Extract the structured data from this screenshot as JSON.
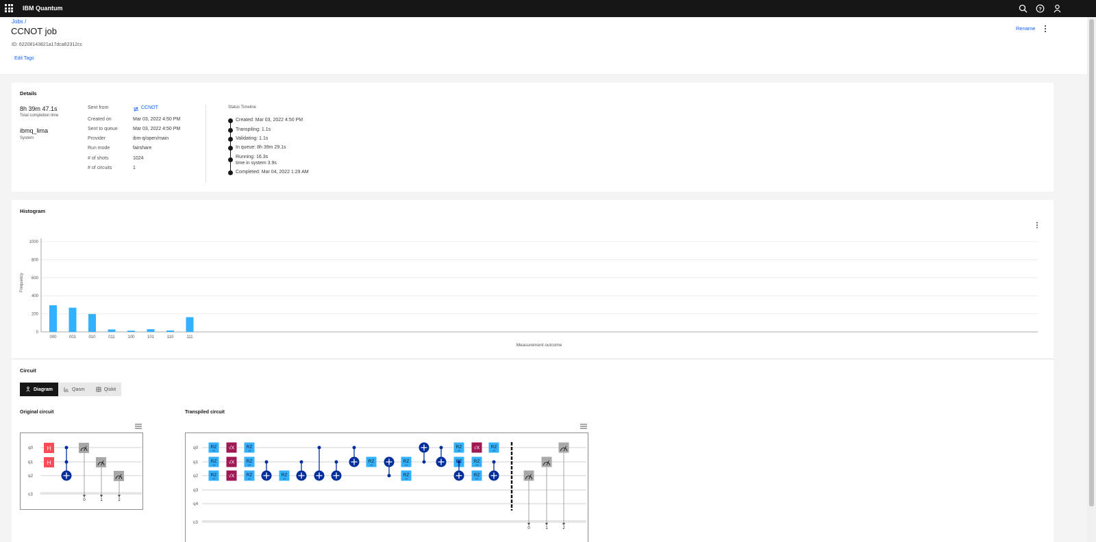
{
  "topbar": {
    "brand": "IBM Quantum",
    "icons": [
      "app-switcher-icon",
      "search-icon",
      "help-icon",
      "user-icon"
    ]
  },
  "header": {
    "breadcrumb": "Jobs /",
    "title": "CCNOT job",
    "job_id": "ID: 62208143821a17dca62312cc",
    "edit_tags": "Edit Tags",
    "rename": "Rename"
  },
  "details": {
    "title": "Details",
    "total_time": "8h 39m 47.1s",
    "total_time_label": "Total completion time",
    "system": "ibmq_lima",
    "system_label": "System",
    "rows": [
      {
        "label": "Sent from",
        "value": "CCNOT"
      },
      {
        "label": "Created on",
        "value": "Mar 03, 2022 4:50 PM"
      },
      {
        "label": "Sent to queue",
        "value": "Mar 03, 2022 4:50 PM"
      },
      {
        "label": "Provider",
        "value": "ibm-q/open/main"
      },
      {
        "label": "Run mode",
        "value": "fairshare"
      },
      {
        "label": "# of shots",
        "value": "1024"
      },
      {
        "label": "# of circuits",
        "value": "1"
      }
    ],
    "timeline_title": "Status Timeline",
    "timeline": [
      {
        "text": "Created: Mar 03, 2022 4:50 PM"
      },
      {
        "text": "Transpiling: 1.1s"
      },
      {
        "text": "Validating: 1.1s"
      },
      {
        "text": "In queue: 8h 39m 29.1s"
      },
      {
        "text": "Running: 16.3s",
        "sub": "time in system 3.9s"
      },
      {
        "text": "Completed: Mar 04, 2022 1:29 AM"
      }
    ]
  },
  "histogram": {
    "title": "Histogram",
    "accent": "#33b1ff"
  },
  "chart_data": {
    "type": "bar",
    "categories": [
      "000",
      "001",
      "010",
      "011",
      "100",
      "101",
      "110",
      "111"
    ],
    "values": [
      295,
      268,
      198,
      27,
      14,
      30,
      16,
      163
    ],
    "xlabel": "Measurement outcome",
    "ylabel": "Frequency",
    "ylim": [
      0,
      1000
    ],
    "yticks": [
      0,
      200,
      400,
      600,
      800,
      1000
    ],
    "grid": true
  },
  "circuit": {
    "title": "Circuit",
    "tabs": [
      {
        "label": "Diagram",
        "active": true,
        "icon": "diagram-icon"
      },
      {
        "label": "Qasm",
        "active": false,
        "icon": "chart-icon"
      },
      {
        "label": "Qiskit",
        "active": false,
        "icon": "table-icon"
      }
    ],
    "original_title": "Original circuit",
    "transpiled_title": "Transpiled circuit",
    "gate_colors": {
      "h": "#fa4d56",
      "rz": "#33b1ff",
      "sx": "#9f1853",
      "cx": "#002d9c",
      "measure": "#a8a8a8"
    },
    "original_qubits": [
      "q0",
      "q1",
      "q2"
    ],
    "transpiled_qubits": [
      "q0",
      "q1",
      "q2",
      "q3",
      "q4"
    ],
    "classical_label": "c3",
    "classical_bits": [
      "0",
      "1",
      "2"
    ],
    "rz_label": "RZ",
    "rz_param": "π/2",
    "h_label": "H",
    "sx_label": "√X"
  }
}
